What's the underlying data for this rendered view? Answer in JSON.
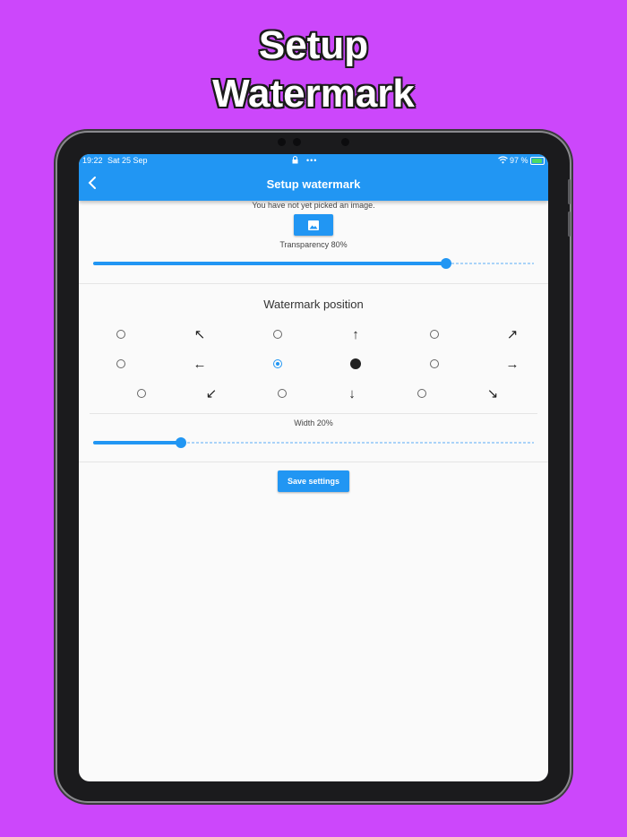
{
  "promo": {
    "line1": "Setup",
    "line2": "Watermark"
  },
  "status_bar": {
    "time": "19:22",
    "date": "Sat 25 Sep",
    "battery": "97 %",
    "more_dots": "•••"
  },
  "app_bar": {
    "title": "Setup watermark",
    "back_icon": "chevron-left-icon"
  },
  "image": {
    "status_text": "You have not yet picked an image.",
    "pick_icon": "image-icon"
  },
  "transparency": {
    "label": "Transparency 80%",
    "value_percent": 80
  },
  "position": {
    "title": "Watermark position",
    "selected": "center",
    "arrows": {
      "up_left": "↖",
      "up": "↑",
      "up_right": "↗",
      "left": "←",
      "right": "→",
      "down_left": "↙",
      "down": "↓",
      "down_right": "↘"
    }
  },
  "width": {
    "label": "Width 20%",
    "value_percent": 20
  },
  "save_label": "Save settings",
  "colors": {
    "accent": "#2196f3",
    "background": "#cc47fb",
    "screen_bg": "#fafafa"
  }
}
